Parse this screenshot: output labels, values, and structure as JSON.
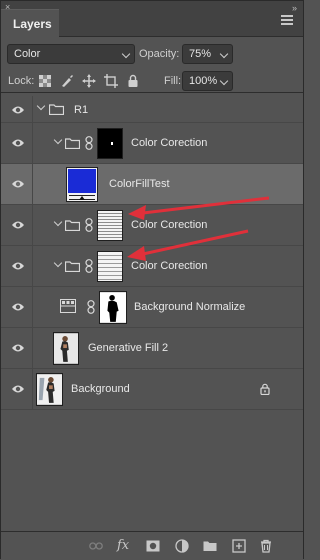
{
  "panel": {
    "close_glyph": "×",
    "collapse_glyph": "»",
    "tab_label": "Layers"
  },
  "controls": {
    "blend_mode": "Color",
    "opacity_label": "Opacity:",
    "opacity_value": "75%",
    "lock_label": "Lock:",
    "fill_label": "Fill:",
    "fill_value": "100%"
  },
  "layers": [
    {
      "name": "R1",
      "kind": "group",
      "indent": 0
    },
    {
      "name": "Color Corection",
      "kind": "group-with-mask",
      "indent": 1
    },
    {
      "name": "ColorFillTest",
      "kind": "fill",
      "indent": 2,
      "selected": true
    },
    {
      "name": "Color Corection",
      "kind": "group-with-mask",
      "indent": 1
    },
    {
      "name": "Color Corection",
      "kind": "group-with-mask",
      "indent": 1
    },
    {
      "name": "Background Normalize",
      "kind": "adjustment-with-mask",
      "indent": 1
    },
    {
      "name": "Generative Fill 2",
      "kind": "image",
      "indent": 0
    },
    {
      "name": "Background",
      "kind": "image-locked",
      "indent": 0
    }
  ],
  "colors": {
    "panel_bg": "#535353",
    "selected_row": "#6b6b6b",
    "fill_thumb": "#1a2bd6",
    "arrow": "#e0303a"
  },
  "bottom_icons": [
    "link-icon",
    "fx-icon",
    "mask-icon",
    "adjustment-icon",
    "group-icon",
    "new-layer-icon",
    "trash-icon"
  ],
  "bottom_fx_label": "fx"
}
